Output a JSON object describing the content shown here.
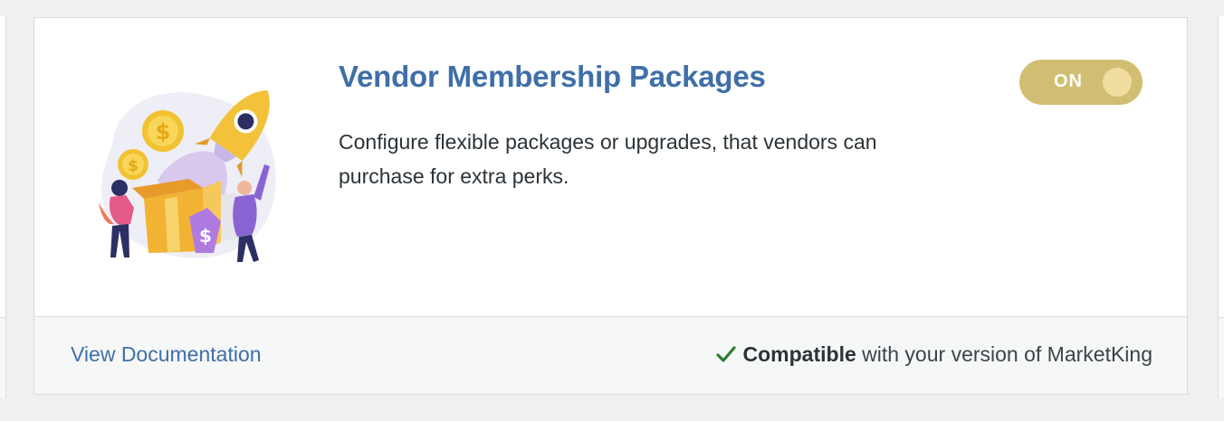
{
  "card": {
    "title": "Vendor Membership Packages",
    "description": "Configure flexible packages or upgrades, that vendors can purchase for extra perks.",
    "toggle": {
      "label": "ON",
      "state": true,
      "color": "#d2be72"
    },
    "illustration_icon": "rocket-gift-box-illustration",
    "footer": {
      "doc_link": "View Documentation",
      "compat_icon": "checkmark-icon",
      "compat_strong": "Compatible",
      "compat_rest": " with your version of MarketKing"
    }
  },
  "colors": {
    "accent": "#3f6fa8",
    "check": "#2e7d32"
  }
}
